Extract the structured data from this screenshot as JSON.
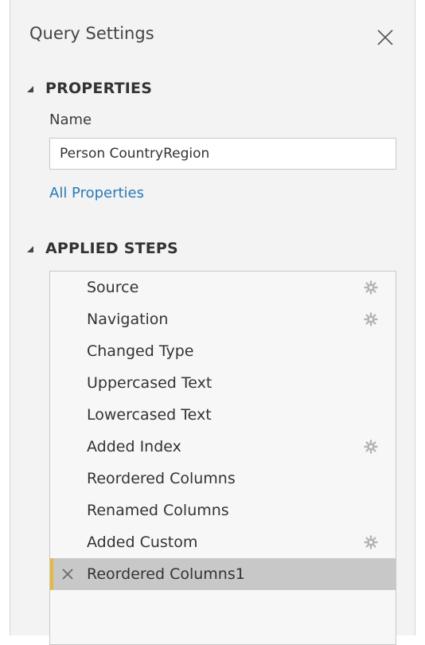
{
  "pane": {
    "title": "Query Settings"
  },
  "properties": {
    "header": "PROPERTIES",
    "name_label": "Name",
    "name_value": "Person CountryRegion",
    "all_properties_link": "All Properties"
  },
  "applied_steps": {
    "header": "APPLIED STEPS",
    "steps": [
      {
        "label": "Source",
        "has_settings": true
      },
      {
        "label": "Navigation",
        "has_settings": true
      },
      {
        "label": "Changed Type",
        "has_settings": false
      },
      {
        "label": "Uppercased Text",
        "has_settings": false
      },
      {
        "label": "Lowercased Text",
        "has_settings": false
      },
      {
        "label": "Added Index",
        "has_settings": true
      },
      {
        "label": "Reordered Columns",
        "has_settings": false
      },
      {
        "label": "Renamed Columns",
        "has_settings": false
      },
      {
        "label": "Added Custom",
        "has_settings": true
      },
      {
        "label": "Reordered Columns1",
        "has_settings": false,
        "selected": true
      }
    ]
  },
  "colors": {
    "link": "#2a7ab8",
    "selection_bg": "#c8c8c8",
    "selection_accent": "#e3b93f",
    "pane_bg": "#f3f3f3"
  },
  "icons": {
    "close": "close-icon",
    "collapse": "collapse-triangle-icon",
    "settings": "gear-icon",
    "delete": "delete-step-icon"
  }
}
